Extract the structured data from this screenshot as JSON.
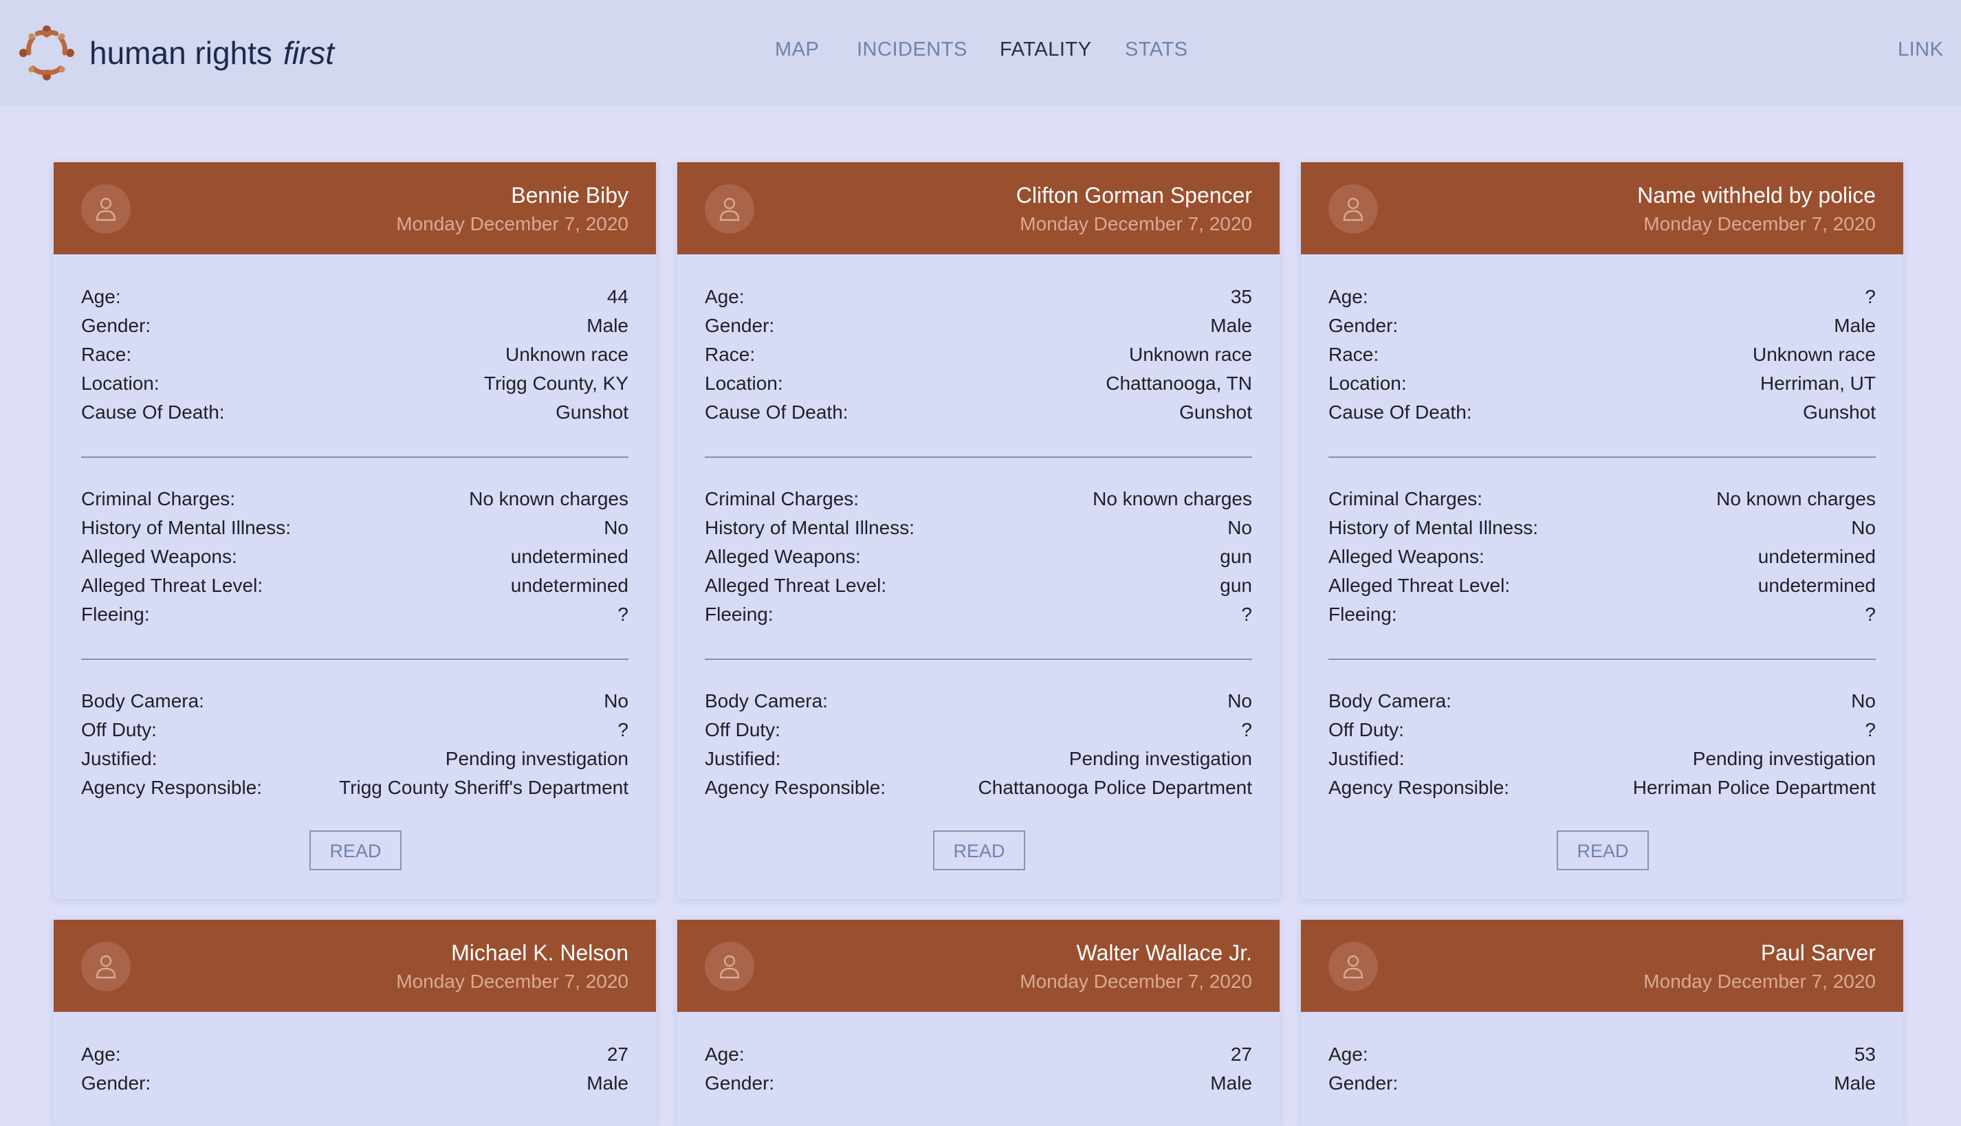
{
  "brand": {
    "name": "human rights",
    "emphasis": "first"
  },
  "nav": {
    "items": [
      {
        "label": "MAP",
        "active": false
      },
      {
        "label": "INCIDENTS",
        "active": false
      },
      {
        "label": "FATALITY",
        "active": true
      },
      {
        "label": "STATS",
        "active": false
      }
    ],
    "link_label": "LINK"
  },
  "colors": {
    "page_bg": "#dcdff7",
    "topbar_bg": "#d3d7f0",
    "card_header": "#9a4f2f",
    "nav_text": "#6e83ad",
    "nav_active": "#2a2f3d"
  },
  "labels": {
    "age": "Age:",
    "gender": "Gender:",
    "race": "Race:",
    "location": "Location:",
    "cause": "Cause Of Death:",
    "charges": "Criminal Charges:",
    "mental": "History of Mental Illness:",
    "weapons": "Alleged Weapons:",
    "threat": "Alleged Threat Level:",
    "fleeing": "Fleeing:",
    "camera": "Body Camera:",
    "offduty": "Off Duty:",
    "justified": "Justified:",
    "agency": "Agency Responsible:",
    "read": "READ"
  },
  "cards": [
    {
      "name": "Bennie Biby",
      "date": "Monday December 7, 2020",
      "age": "44",
      "gender": "Male",
      "race": "Unknown race",
      "location": "Trigg County, KY",
      "cause": "Gunshot",
      "charges": "No known charges",
      "mental": "No",
      "weapons": "undetermined",
      "threat": "undetermined",
      "fleeing": "?",
      "camera": "No",
      "offduty": "?",
      "justified": "Pending investigation",
      "agency": "Trigg County Sheriff's Department"
    },
    {
      "name": "Clifton Gorman Spencer",
      "date": "Monday December 7, 2020",
      "age": "35",
      "gender": "Male",
      "race": "Unknown race",
      "location": "Chattanooga, TN",
      "cause": "Gunshot",
      "charges": "No known charges",
      "mental": "No",
      "weapons": "gun",
      "threat": "gun",
      "fleeing": "?",
      "camera": "No",
      "offduty": "?",
      "justified": "Pending investigation",
      "agency": "Chattanooga Police Department"
    },
    {
      "name": "Name withheld by police",
      "date": "Monday December 7, 2020",
      "age": "?",
      "gender": "Male",
      "race": "Unknown race",
      "location": "Herriman, UT",
      "cause": "Gunshot",
      "charges": "No known charges",
      "mental": "No",
      "weapons": "undetermined",
      "threat": "undetermined",
      "fleeing": "?",
      "camera": "No",
      "offduty": "?",
      "justified": "Pending investigation",
      "agency": "Herriman Police Department"
    },
    {
      "name": "Michael K. Nelson",
      "date": "Monday December 7, 2020",
      "age": "27",
      "gender": "Male"
    },
    {
      "name": "Walter Wallace Jr.",
      "date": "Monday December 7, 2020",
      "age": "27",
      "gender": "Male"
    },
    {
      "name": "Paul Sarver",
      "date": "Monday December 7, 2020",
      "age": "53",
      "gender": "Male"
    }
  ]
}
